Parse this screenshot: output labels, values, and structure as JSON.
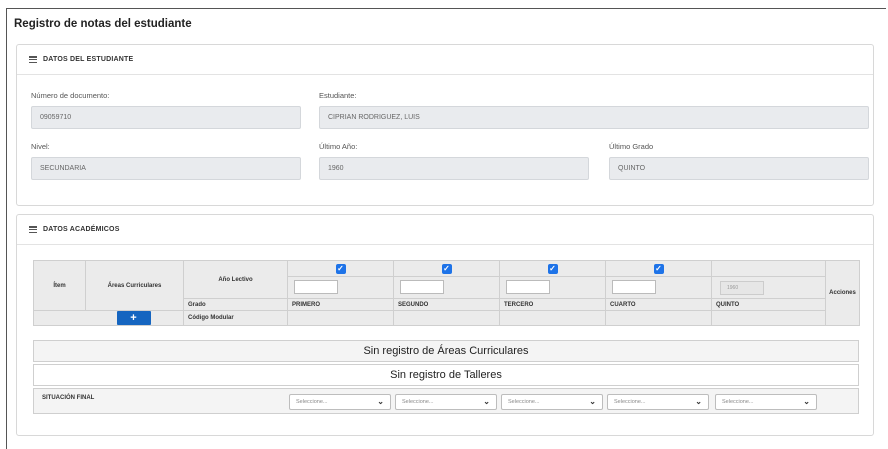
{
  "page": {
    "title": "Registro de notas del estudiante"
  },
  "student_panel": {
    "header": "DATOS DEL ESTUDIANTE",
    "fields": {
      "documento": {
        "label": "Número de documento:",
        "value": "09059710"
      },
      "estudiante": {
        "label": "Estudiante:",
        "value": "CIPRIAN RODRIGUEZ, LUIS"
      },
      "nivel": {
        "label": "Nivel:",
        "value": "SECUNDARIA"
      },
      "ultimo_anio": {
        "label": "Último Año:",
        "value": "1960"
      },
      "ultimo_grado": {
        "label": "Último Grado",
        "value": "QUINTO"
      }
    }
  },
  "academic_panel": {
    "header": "DATOS ACADÉMICOS",
    "table": {
      "col_item": "Ítem",
      "col_areas": "Áreas Curriculares",
      "row_anio": "Año Lectivo",
      "row_grado": "Grado",
      "row_codigo": "Código Modular",
      "col_acciones": "Acciones",
      "add_button": "+",
      "year_placeholder": "1960",
      "grades": [
        {
          "name": "PRIMERO",
          "checked": true
        },
        {
          "name": "SEGUNDO",
          "checked": true
        },
        {
          "name": "TERCERO",
          "checked": true
        },
        {
          "name": "CUARTO",
          "checked": true
        },
        {
          "name": "QUINTO",
          "checked": false
        }
      ]
    },
    "empty_areas": "Sin registro de Áreas Curriculares",
    "empty_talleres": "Sin registro de Talleres",
    "situacion_final": {
      "label": "SITUACIÓN FINAL",
      "select_placeholder": "Seleccione..."
    }
  },
  "colors": {
    "accent": "#1e73e8",
    "button": "#1565c0",
    "input_bg": "#e9ebee",
    "table_head_bg": "#ebebeb"
  },
  "icons": {
    "panel_header": "list-icon",
    "checkbox": "checkbox-checked-icon",
    "select": "chevron-down-icon"
  }
}
